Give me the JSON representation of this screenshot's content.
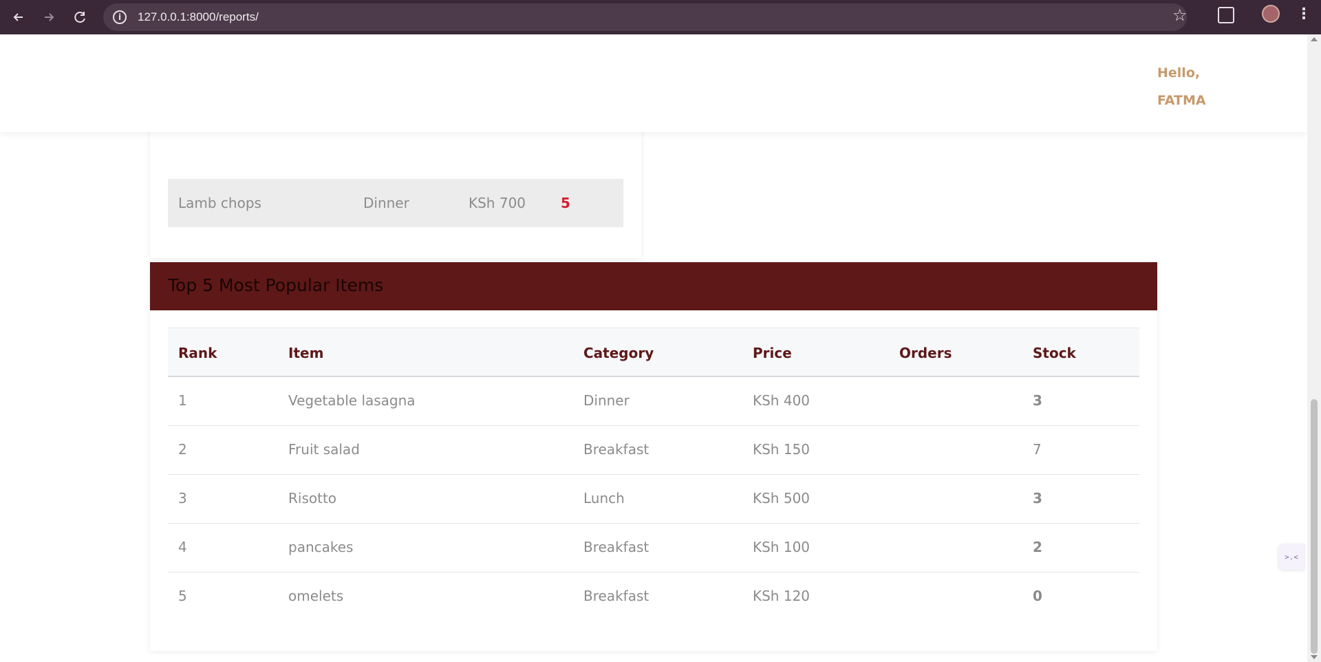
{
  "browser": {
    "url": "127.0.0.1:8000/reports/",
    "back_icon": "arrow-left-icon",
    "forward_icon": "arrow-right-icon",
    "reload_icon": "reload-icon"
  },
  "header": {
    "greeting_line1": "Hello,",
    "greeting_line2": "FATMA"
  },
  "low_stock_card": {
    "row": {
      "item": "Lamb chops",
      "category": "Dinner",
      "price": "KSh 700",
      "stock": "5"
    }
  },
  "popular": {
    "title": "Top 5 Most Popular Items",
    "columns": [
      "Rank",
      "Item",
      "Category",
      "Price",
      "Orders",
      "Stock"
    ],
    "rows": [
      {
        "rank": "1",
        "item": "Vegetable lasagna",
        "category": "Dinner",
        "price": "KSh 400",
        "orders": "",
        "stock": "3",
        "low": true
      },
      {
        "rank": "2",
        "item": "Fruit salad",
        "category": "Breakfast",
        "price": "KSh 150",
        "orders": "",
        "stock": "7",
        "low": false
      },
      {
        "rank": "3",
        "item": "Risotto",
        "category": "Lunch",
        "price": "KSh 500",
        "orders": "",
        "stock": "3",
        "low": true
      },
      {
        "rank": "4",
        "item": "pancakes",
        "category": "Breakfast",
        "price": "KSh 100",
        "orders": "",
        "stock": "2",
        "low": true
      },
      {
        "rank": "5",
        "item": "omelets",
        "category": "Breakfast",
        "price": "KSh 120",
        "orders": "",
        "stock": "0",
        "low": true
      }
    ]
  },
  "widget": {
    "label": ">.<"
  },
  "colors": {
    "brand": "#5e1818",
    "accent": "#c7996a",
    "low_stock": "#d31d32"
  }
}
